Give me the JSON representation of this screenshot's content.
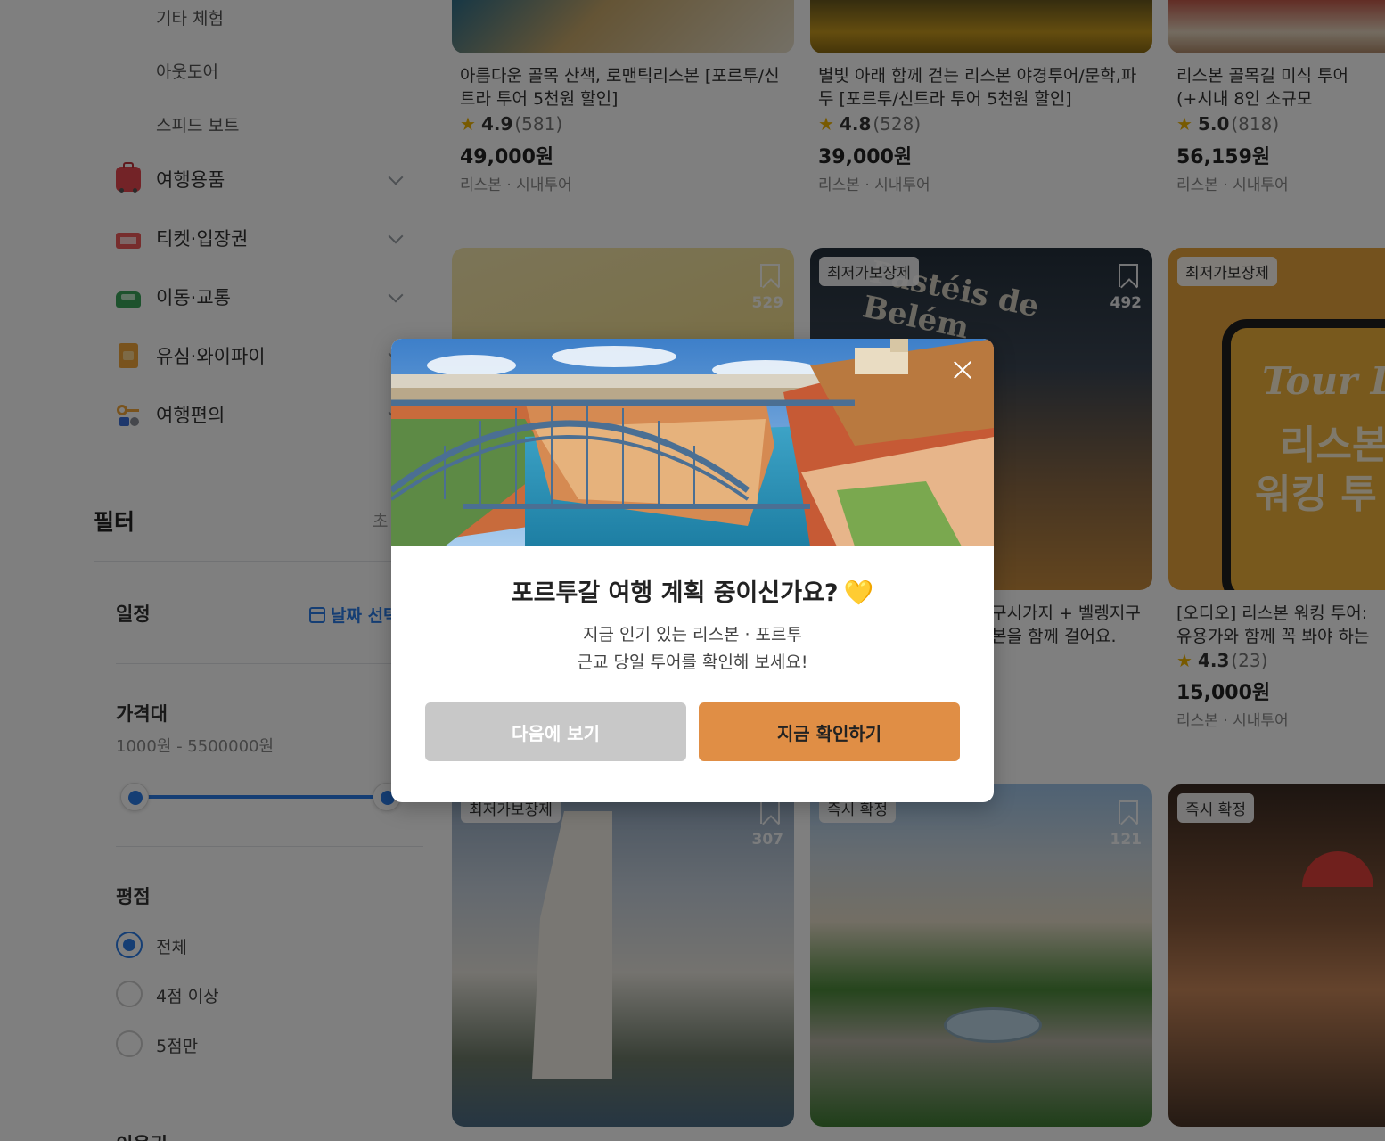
{
  "sidebar": {
    "sub_items": [
      "기타 체험",
      "아웃도어",
      "스피드 보트"
    ],
    "categories": [
      {
        "label": "여행용품",
        "icon": "luggage-icon"
      },
      {
        "label": "티켓·입장권",
        "icon": "ticket-icon"
      },
      {
        "label": "이동·교통",
        "icon": "car-icon"
      },
      {
        "label": "유심·와이파이",
        "icon": "sim-card-icon"
      },
      {
        "label": "여행편의",
        "icon": "key-icon"
      }
    ],
    "filter_title": "필터",
    "filter_reset": "초",
    "schedule_label": "일정",
    "date_select_label": "날짜 선택",
    "price_label": "가격대",
    "price_range": "1000원 - 5500000원",
    "rating_label": "평점",
    "rating_options": [
      {
        "label": "전체",
        "selected": true
      },
      {
        "label": "4점 이상",
        "selected": false
      },
      {
        "label": "5점만",
        "selected": false
      }
    ],
    "next_section_label": "이용권"
  },
  "products": {
    "row1": [
      {
        "title": "아름다운 골목 산책, 로맨틱리스본 [포르투/신트라 투어 5천원 할인]",
        "rating": "4.9",
        "count": "(581)",
        "price": "49,000원",
        "meta": "리스본 · 시내투어"
      },
      {
        "title": "별빛 아래 함께 걷는 리스본 야경투어/문학,파두 [포르투/신트라 투어 5천원 할인]",
        "rating": "4.8",
        "count": "(528)",
        "price": "39,000원",
        "meta": "리스본 · 시내투어"
      },
      {
        "title": "리스본 골목길 미식 투어(+시내 8인 소규모",
        "rating": "5.0",
        "count": "(818)",
        "price": "56,159원",
        "meta": "리스본 · 시내투어"
      }
    ],
    "row2": [
      {
        "badge": "",
        "saves": "529"
      },
      {
        "badge": "최저가보장제",
        "saves": "492",
        "title_partial": "구시가지 + 벨렝지구 본을 함께 걸어요.",
        "sign_text": "Pastéis de Belém"
      },
      {
        "badge": "최저가보장제",
        "title": "[오디오] 리스본 워킹 투어: 유용가와 함께 꼭 봐야 하는 시내",
        "rating": "4.3",
        "count": "(23)",
        "price": "15,000원",
        "meta": "리스본 · 시내투어",
        "phone_script": "Tour Li",
        "phone_line1": "리스본",
        "phone_line2": "워킹 투"
      }
    ],
    "row3": [
      {
        "badge": "최저가보장제",
        "saves": "307"
      },
      {
        "badge": "즉시 확정",
        "saves": "121"
      },
      {
        "badge": "즉시 확정"
      }
    ]
  },
  "modal": {
    "title": "포르투갈 여행 계획 중이신가요?",
    "heart": "💛",
    "body_line1": "지금 인기 있는 리스본 · 포르투",
    "body_line2": "근교 당일 투어를 확인해 보세요!",
    "later_button": "다음에 보기",
    "go_button": "지금 확인하기"
  },
  "colors": {
    "accent_blue": "#2b7de9",
    "cta_orange": "#e08e45",
    "later_gray": "#c8c8c8",
    "star": "#f0b400"
  }
}
